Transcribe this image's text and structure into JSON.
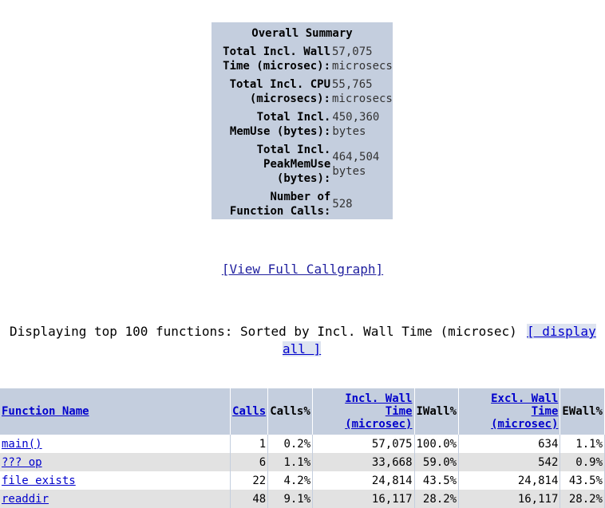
{
  "summary": {
    "title": "Overall Summary",
    "rows": [
      {
        "label": "Total Incl. Wall Time (microsec):",
        "value": "57,075 microsecs"
      },
      {
        "label": "Total Incl. CPU (microsecs):",
        "value": "55,765 microsecs"
      },
      {
        "label": "Total Incl. MemUse (bytes):",
        "value": "450,360 bytes"
      },
      {
        "label": "Total Incl. PeakMemUse (bytes):",
        "value": "464,504 bytes"
      },
      {
        "label": "Number of Function Calls:",
        "value": "528"
      }
    ]
  },
  "callgraph_link": "[View Full Callgraph]",
  "sort": {
    "text": "Displaying top 100 functions: Sorted by Incl. Wall Time (microsec)",
    "display_all_part1": "[ display",
    "display_all_part2": "all ]"
  },
  "table": {
    "headers": {
      "function_name": "Function Name",
      "calls": "Calls",
      "calls_pct": "Calls%",
      "incl_wall": "Incl. Wall Time (microsec)",
      "iwall_pct": "IWall%",
      "excl_wall": "Excl. Wall Time (microsec)",
      "ewall": "EWall%"
    },
    "rows": [
      {
        "name": "main()",
        "calls": "1",
        "calls_pct": "0.2%",
        "incl_wall": "57,075",
        "iwall_pct": "100.0%",
        "excl_wall": "634",
        "ewall": "1.1%"
      },
      {
        "name": "??? op",
        "calls": "6",
        "calls_pct": "1.1%",
        "incl_wall": "33,668",
        "iwall_pct": "59.0%",
        "excl_wall": "542",
        "ewall": "0.9%"
      },
      {
        "name": "file exists",
        "calls": "22",
        "calls_pct": "4.2%",
        "incl_wall": "24,814",
        "iwall_pct": "43.5%",
        "excl_wall": "24,814",
        "ewall": "43.5%"
      },
      {
        "name": "readdir",
        "calls": "48",
        "calls_pct": "9.1%",
        "incl_wall": "16,117",
        "iwall_pct": "28.2%",
        "excl_wall": "16,117",
        "ewall": "28.2%"
      }
    ]
  }
}
